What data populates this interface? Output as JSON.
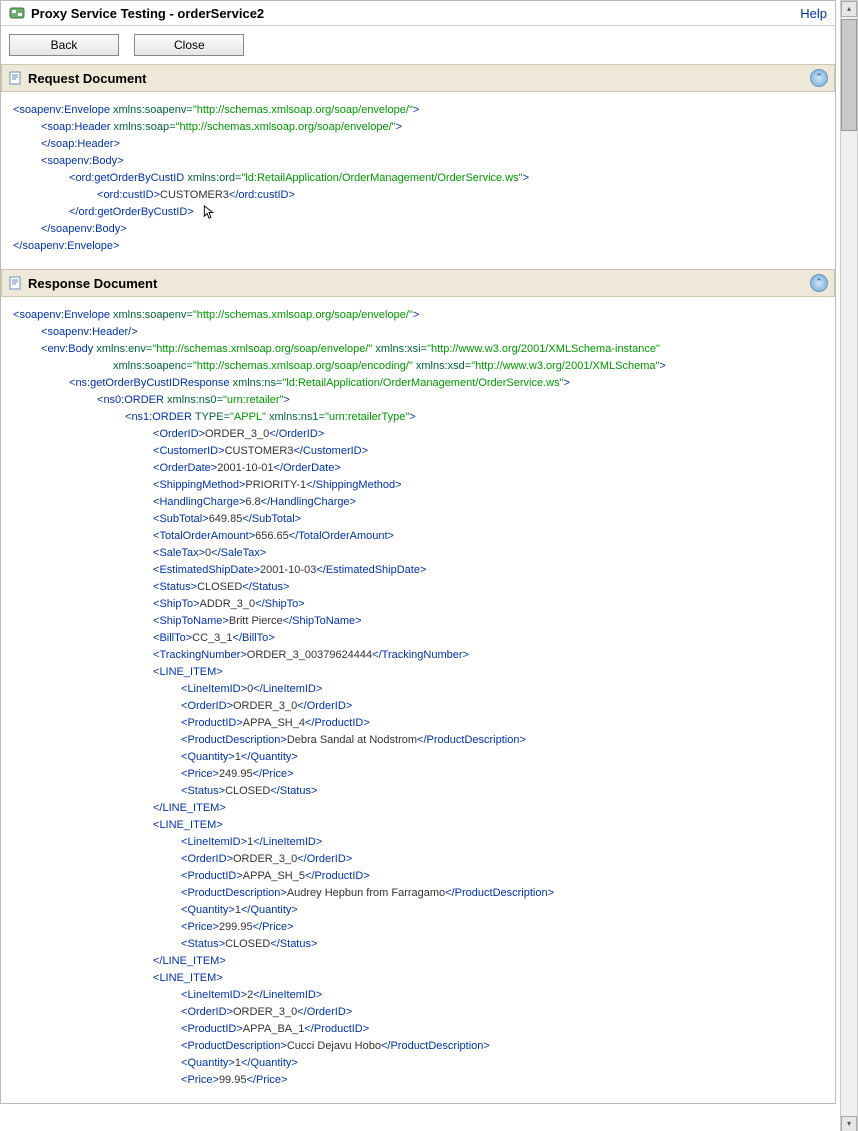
{
  "header": {
    "title": "Proxy Service Testing - orderService2",
    "help": "Help",
    "back": "Back",
    "close": "Close"
  },
  "sections": {
    "request": "Request Document",
    "response": "Response Document"
  },
  "request": {
    "env_ns_attr": "xmlns:soapenv",
    "env_ns_val": "\"http://schemas.xmlsoap.org/soap/envelope/\"",
    "header_ns_attr": "xmlns:soap",
    "header_ns_val": "\"http://schemas.xmlsoap.org/soap/envelope/\"",
    "op_tag": "ord:getOrderByCustID",
    "op_ns_attr": "xmlns:ord",
    "op_ns_val": "\"ld:RetailApplication/OrderManagement/OrderService.ws\"",
    "custid_tag": "ord:custID",
    "custid_val": "CUSTOMER3"
  },
  "response": {
    "env_ns_attr": "xmlns:soapenv",
    "env_ns_val": "\"http://schemas.xmlsoap.org/soap/envelope/\"",
    "body_tag": "env:Body",
    "body_env_attr": "xmlns:env",
    "body_env_val": "\"http://schemas.xmlsoap.org/soap/envelope/\"",
    "body_xsi_attr": "xmlns:xsi",
    "body_xsi_val": "\"http://www.w3.org/2001/XMLSchema-instance\"",
    "body_soapenc_attr": "xmlns:soapenc",
    "body_soapenc_val": "\"http://schemas.xmlsoap.org/soap/encoding/\"",
    "body_xsd_attr": "xmlns:xsd",
    "body_xsd_val": "\"http://www.w3.org/2001/XMLSchema\"",
    "resp_tag": "ns:getOrderByCustIDResponse",
    "resp_ns_attr": "xmlns:ns",
    "resp_ns_val": "\"ld:RetailApplication/OrderManagement/OrderService.ws\"",
    "ns0_tag": "ns0:ORDER",
    "ns0_attr": "xmlns:ns0",
    "ns0_val": "\"urn:retailer\"",
    "ns1_tag": "ns1:ORDER",
    "ns1_type_attr": "TYPE",
    "ns1_type_val": "\"APPL\"",
    "ns1_ns_attr": "xmlns:ns1",
    "ns1_ns_val": "\"urn:retailerType\"",
    "order": {
      "OrderID": "ORDER_3_0",
      "CustomerID": "CUSTOMER3",
      "OrderDate": "2001-10-01",
      "ShippingMethod": "PRIORITY-1",
      "HandlingCharge": "6.8",
      "SubTotal": "649.85",
      "TotalOrderAmount": "656.65",
      "SaleTax": "0",
      "EstimatedShipDate": "2001-10-03",
      "Status": "CLOSED",
      "ShipTo": "ADDR_3_0",
      "ShipToName": "Britt Pierce",
      "BillTo": "CC_3_1",
      "TrackingNumber": "ORDER_3_00379624444"
    },
    "line_items": [
      {
        "LineItemID": "0",
        "OrderID": "ORDER_3_0",
        "ProductID": "APPA_SH_4",
        "ProductDescription": "Debra Sandal at Nodstrom",
        "Quantity": "1",
        "Price": "249.95",
        "Status": "CLOSED"
      },
      {
        "LineItemID": "1",
        "OrderID": "ORDER_3_0",
        "ProductID": "APPA_SH_5",
        "ProductDescription": "Audrey Hepbun from Farragamo",
        "Quantity": "1",
        "Price": "299.95",
        "Status": "CLOSED"
      },
      {
        "LineItemID": "2",
        "OrderID": "ORDER_3_0",
        "ProductID": "APPA_BA_1",
        "ProductDescription": "Cucci Dejavu Hobo",
        "Quantity": "1",
        "Price": "99.95"
      }
    ]
  }
}
